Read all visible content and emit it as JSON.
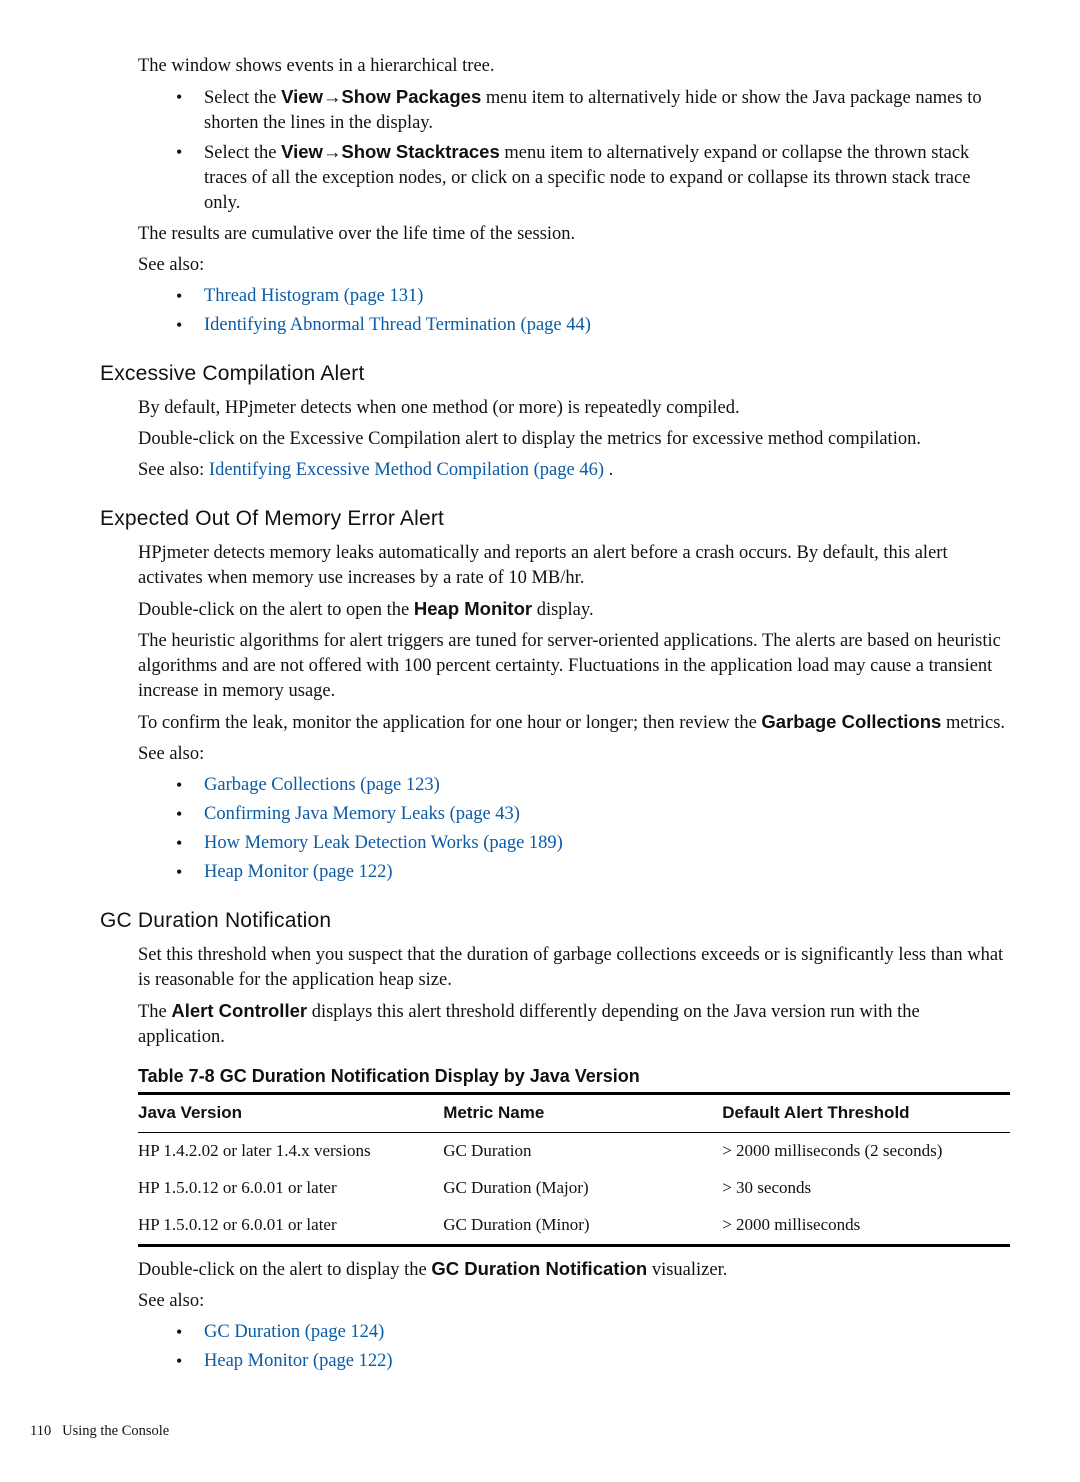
{
  "intro": {
    "p1": "The window shows events in a hierarchical tree.",
    "b1_pre": "Select the ",
    "b1_bold": "View→Show Packages",
    "b1_post": " menu item to alternatively hide or show the Java package names to shorten the lines in the display.",
    "b2_pre": "Select the ",
    "b2_bold": "View→Show Stacktraces",
    "b2_post": " menu item to alternatively expand or collapse the thrown stack traces of all the exception nodes, or click on a specific node to expand or collapse its thrown stack trace only.",
    "p2": "The results are cumulative over the life time of the session.",
    "p3": "See also:",
    "link1": "Thread Histogram (page 131)",
    "link2": "Identifying Abnormal Thread Termination (page 44)"
  },
  "exc": {
    "title": "Excessive Compilation Alert",
    "p1": "By default, HPjmeter detects when one method (or more) is repeatedly compiled.",
    "p2": "Double-click on the Excessive Compilation alert to display the metrics for excessive method compilation.",
    "p3_pre": "See also: ",
    "p3_link": "Identifying Excessive Method Compilation (page 46) ",
    "p3_post": "."
  },
  "oom": {
    "title": "Expected Out Of Memory Error Alert",
    "p1": "HPjmeter detects memory leaks automatically and reports an alert before a crash occurs. By default, this alert activates when memory use increases by a rate of 10 MB/hr.",
    "p2_pre": "Double-click on the alert to open the ",
    "p2_bold": "Heap Monitor",
    "p2_post": " display.",
    "p3": "The heuristic algorithms for alert triggers are tuned for server-oriented applications. The alerts are based on heuristic algorithms and are not offered with 100 percent certainty. Fluctuations in the application load may cause a transient increase in memory usage.",
    "p4_pre": "To confirm the leak, monitor the application for one hour or longer; then review the ",
    "p4_bold": "Garbage Collections",
    "p4_post": " metrics.",
    "p5": "See also:",
    "link1": "Garbage Collections (page 123)",
    "link2": "Confirming Java Memory Leaks (page 43)",
    "link3": "How Memory Leak Detection Works (page 189)",
    "link4": "Heap Monitor (page 122)"
  },
  "gc": {
    "title": "GC Duration Notification",
    "p1": "Set this threshold when you suspect that the duration of garbage collections exceeds or is significantly less than what is reasonable for the application heap size.",
    "p2_pre": "The ",
    "p2_bold": "Alert Controller",
    "p2_post": " displays this alert threshold differently depending on the Java version run with the application.",
    "tabletitle": "Table 7-8 GC Duration Notification Display by Java Version",
    "th1": "Java Version",
    "th2": "Metric Name",
    "th3": "Default Alert Threshold",
    "rows": [
      {
        "c1": "HP 1.4.2.02 or later 1.4.x versions",
        "c2": "GC Duration",
        "c3": "> 2000 milliseconds (2 seconds)"
      },
      {
        "c1": "HP 1.5.0.12 or 6.0.01 or later",
        "c2": "GC Duration (Major)",
        "c3": "> 30 seconds"
      },
      {
        "c1": "HP 1.5.0.12 or 6.0.01 or later",
        "c2": "GC Duration (Minor)",
        "c3": "> 2000 milliseconds"
      }
    ],
    "p3_pre": "Double-click on the alert to display the ",
    "p3_bold": "GC Duration Notification",
    "p3_post": " visualizer.",
    "p4": "See also:",
    "link1": "GC Duration (page 124)",
    "link2": "Heap Monitor (page 122)"
  },
  "footer": {
    "page": "110",
    "section": "Using the Console"
  }
}
